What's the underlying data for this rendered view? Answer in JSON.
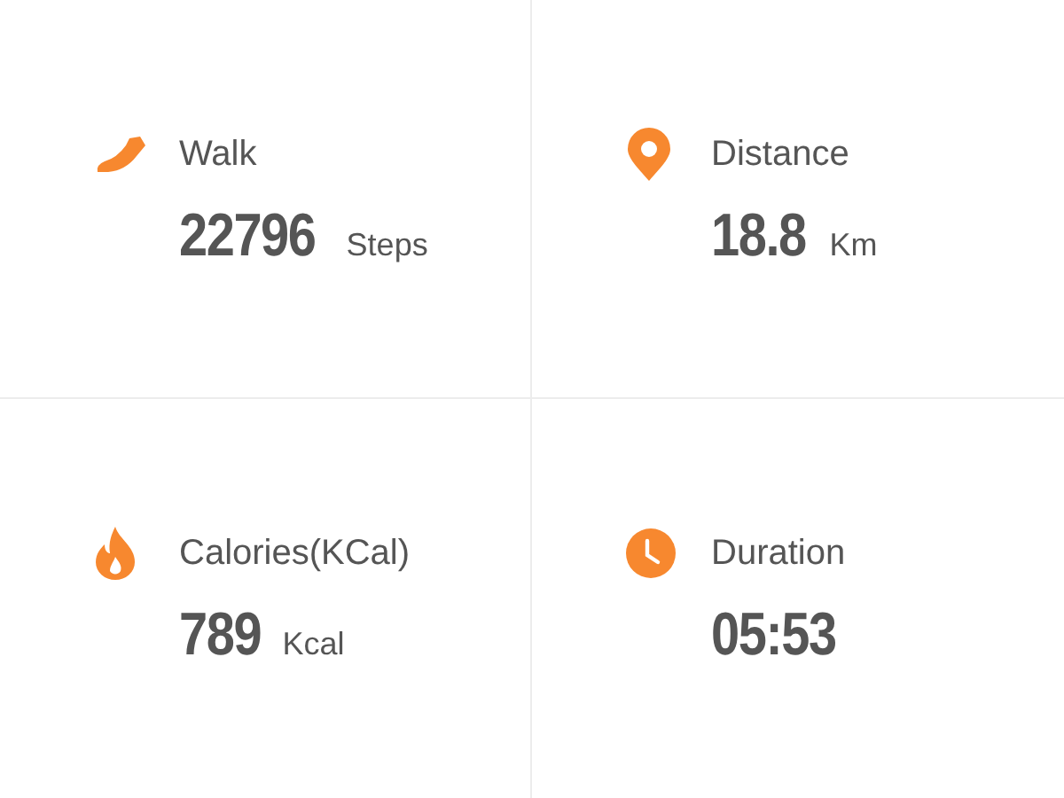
{
  "stats": [
    {
      "kind": "walk",
      "label": "Walk",
      "value": "22796",
      "unit": "Steps"
    },
    {
      "kind": "distance",
      "label": "Distance",
      "value": "18.8",
      "unit": "Km"
    },
    {
      "kind": "calories",
      "label": "Calories(KCal)",
      "value": "789",
      "unit": "Kcal"
    },
    {
      "kind": "duration",
      "label": "Duration",
      "value": "05:53"
    }
  ]
}
